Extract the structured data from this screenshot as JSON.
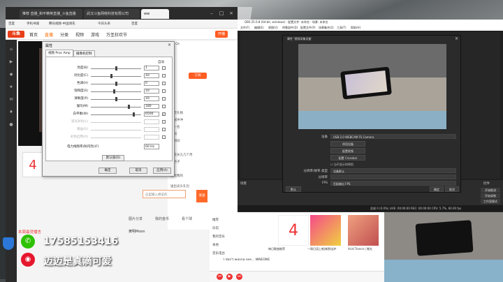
{
  "browser": {
    "tabs": [
      {
        "label": "推荐 直播_和平精英直播_斗鱼直播",
        "active": false
      },
      {
        "label": "武汉斗鱼网络科技有限公司",
        "active": false
      },
      {
        "label": "ww",
        "active": true
      }
    ],
    "bookmarks": [
      "百度",
      "手机书城",
      "腾讯视频-中国领先",
      "今日头条",
      "百度"
    ],
    "nav": [
      "首页",
      "直播",
      "分类",
      "视频",
      "游戏",
      "万圣狂欢节"
    ],
    "nav_highlight_index": 1,
    "nav_right_btn": "开播",
    "follow_label": "订阅",
    "follow_count": "00 Qs",
    "right_lines": [
      "一次礼物",
      "神秘冲冲",
      "第一名",
      "相同",
      "抢时间",
      "一次长久几个月",
      "金丹子",
      "送给我的",
      "送出光头礼包"
    ],
    "chat_placeholder": "这里输入想说的",
    "send_label": "发送",
    "bottom_tabs": [
      "图片分享",
      "我的金币",
      "看个球"
    ],
    "hot_announcement": "本周最烫播言",
    "username": "黄明Moon",
    "thumb_number": "4",
    "side_icons": [
      "home-icon",
      "video-icon",
      "game-icon",
      "star-icon",
      "message-icon",
      "gift-icon",
      "user-icon"
    ]
  },
  "props_dialog": {
    "title": "属性",
    "tabs": [
      "视频 Proc Amp",
      "摄像机控制"
    ],
    "active_tab": 0,
    "auto_header": "自动",
    "rows": [
      {
        "label": "亮度(B)",
        "value": "1",
        "pos": 0.5,
        "enabled": true,
        "auto": false
      },
      {
        "label": "对比度(C)",
        "value": "10",
        "pos": 0.4,
        "enabled": true,
        "auto": false
      },
      {
        "label": "色调(H)",
        "value": "0",
        "pos": 0.5,
        "enabled": true,
        "auto": false
      },
      {
        "label": "饱和度(S)",
        "value": "10",
        "pos": 0.45,
        "enabled": true,
        "auto": false
      },
      {
        "label": "清晰度(P)",
        "value": "10",
        "pos": 0.5,
        "enabled": true,
        "auto": false
      },
      {
        "label": "伽玛(M)",
        "value": "180",
        "pos": 0.75,
        "enabled": true,
        "auto": false
      },
      {
        "label": "白平衡(W)",
        "value": "6500",
        "pos": 0.85,
        "enabled": true,
        "auto": true
      },
      {
        "label": "逆光对比(L)",
        "value": "",
        "pos": 0.0,
        "enabled": false,
        "auto": false
      },
      {
        "label": "增益(G)",
        "value": "",
        "pos": 0.0,
        "enabled": false,
        "auto": false
      },
      {
        "label": "彩色启用(O)",
        "value": "",
        "pos": 0.0,
        "enabled": false,
        "auto": false
      }
    ],
    "freq_label": "电力线频率(防闪烁)(F)",
    "freq_value": "60 Hz",
    "default_label": "默认值(D)",
    "buttons": [
      "确定",
      "取消",
      "应用(A)"
    ]
  },
  "obs": {
    "title": "OBS 25.0.8 (64-bit, windows) - 配置文件: 未命名 - 场景: 未命名",
    "menu": [
      "文件(F)",
      "编辑(E)",
      "视图(V)",
      "停靠部件(D)",
      "配置文件(P)",
      "场景集合(S)",
      "工具(T)",
      "帮助(H)"
    ],
    "docks": [
      "场景",
      "来源",
      "混音器",
      "转场特效",
      "控件"
    ],
    "controls": [
      "开始推流",
      "开始录制",
      "工作室模式",
      "设置",
      "退出"
    ],
    "status": "丢帧 0 (0.0%)   LIVE: 00:00:00   REC: 00:00:00   CPU: 5.7%, 60.00 fps"
  },
  "cam_dialog": {
    "title": "属性 '视频采集设备'",
    "device_label": "设备",
    "device_value": "USB 2.0 WEBCAM FS Camera",
    "btn_deactivate": "停用设备",
    "btn_config_video": "配置视频",
    "btn_config_crossbar": "配置 Crossbar",
    "checkbox_label": "当不显示时停用",
    "res_label": "分辨率/帧率 类型",
    "res_value": "设备默认",
    "res2_label": "分辨率",
    "fps_label": "FPS",
    "fps_value": "匹配输出 FPS",
    "btn_defaults": "默认",
    "btn_ok": "确定",
    "btn_cancel": "取消"
  },
  "music": {
    "side_items": [
      "推荐",
      "乐馆",
      "我的音乐",
      "本地",
      "音乐电台"
    ],
    "cards": [
      {
        "caption": "每日歌曲推荐"
      },
      {
        "caption": "一周日语上新|新鲜出炉"
      },
      {
        "caption": "Acid Trance | 微光"
      },
      {
        "caption": "Artist"
      }
    ],
    "song": "I don't wanna see... NINEONE"
  },
  "overlay": {
    "wechat": "17585153416",
    "weibo": "迈迈是真滴可爱"
  },
  "colors": {
    "accent": "#ff5d23",
    "obs_bg": "#1f1f1f",
    "wechat": "#2dc100",
    "weibo": "#e6162d"
  }
}
